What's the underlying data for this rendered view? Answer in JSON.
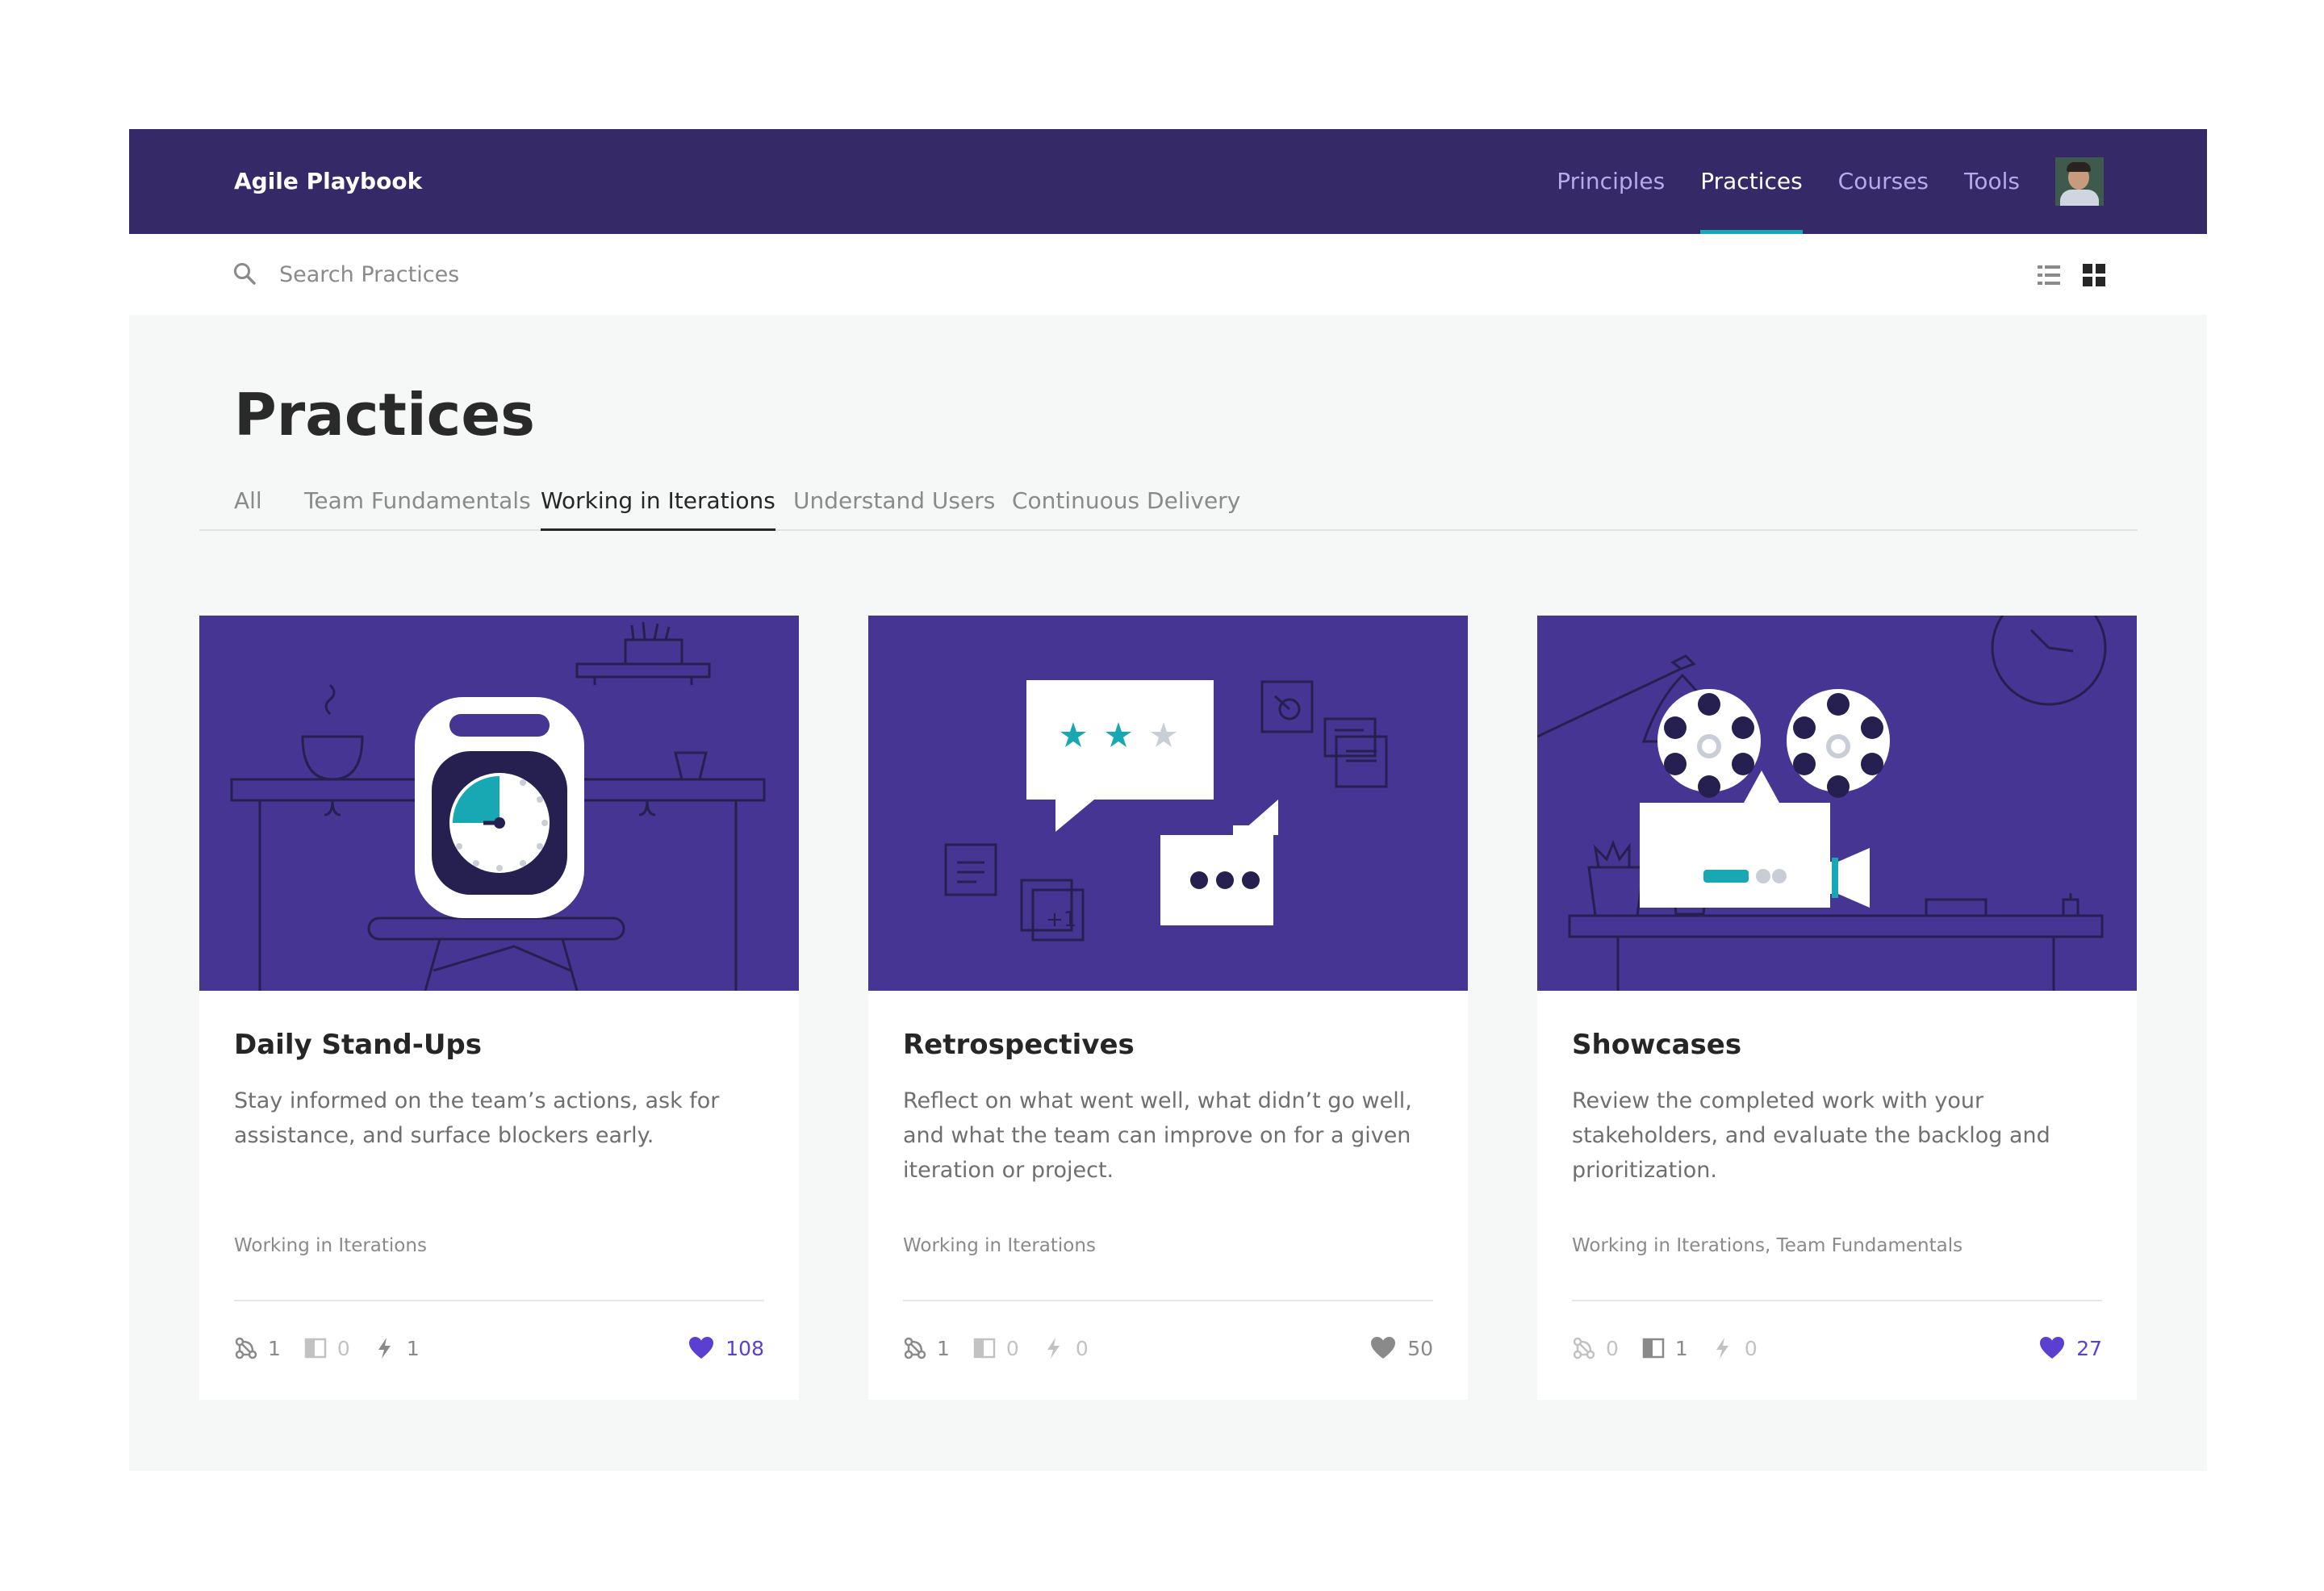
{
  "app": {
    "title": "Agile Playbook"
  },
  "nav": {
    "items": [
      {
        "label": "Principles",
        "active": false
      },
      {
        "label": "Practices",
        "active": true
      },
      {
        "label": "Courses",
        "active": false
      },
      {
        "label": "Tools",
        "active": false
      }
    ],
    "avatar_icon": "user-avatar"
  },
  "search": {
    "placeholder": "Search Practices",
    "value": "",
    "icon": "search-icon"
  },
  "view_toggle": {
    "options": [
      "list-view",
      "grid-view"
    ],
    "selected": "grid-view"
  },
  "page": {
    "title": "Practices"
  },
  "filters": {
    "tabs": [
      {
        "label": "All",
        "active": false
      },
      {
        "label": "Team Fundamentals",
        "active": false
      },
      {
        "label": "Working in Iterations",
        "active": true
      },
      {
        "label": "Understand Users",
        "active": false
      },
      {
        "label": "Continuous Delivery",
        "active": false
      }
    ]
  },
  "cards": [
    {
      "title": "Daily Stand-Ups",
      "description": "Stay informed on the team’s actions, ask for assistance, and surface blockers early.",
      "tags": "Working in Iterations",
      "illustration": "alarm-clock-illustration",
      "stats": {
        "links": "1",
        "pages": "0",
        "bolts": "1"
      },
      "likes": "108",
      "liked": true
    },
    {
      "title": "Retrospectives",
      "description": "Reflect on what went well, what didn’t go well, and what the team can improve on for a given iteration or project.",
      "tags": "Working in Iterations",
      "illustration": "chat-bubbles-illustration",
      "stats": {
        "links": "1",
        "pages": "0",
        "bolts": "0"
      },
      "likes": "50",
      "liked": false
    },
    {
      "title": "Showcases",
      "description": "Review the completed work with your stakeholders, and evaluate the backlog and prioritization.",
      "tags": "Working in Iterations, Team Fundamentals",
      "illustration": "film-projector-illustration",
      "stats": {
        "links": "0",
        "pages": "1",
        "bolts": "0"
      },
      "likes": "27",
      "liked": true
    }
  ],
  "colors": {
    "nav_bg": "#352968",
    "accent_teal": "#18a8b4",
    "card_art_bg": "#463592",
    "like_active": "#5a3fd0",
    "like_inactive": "#8a8a8a"
  }
}
